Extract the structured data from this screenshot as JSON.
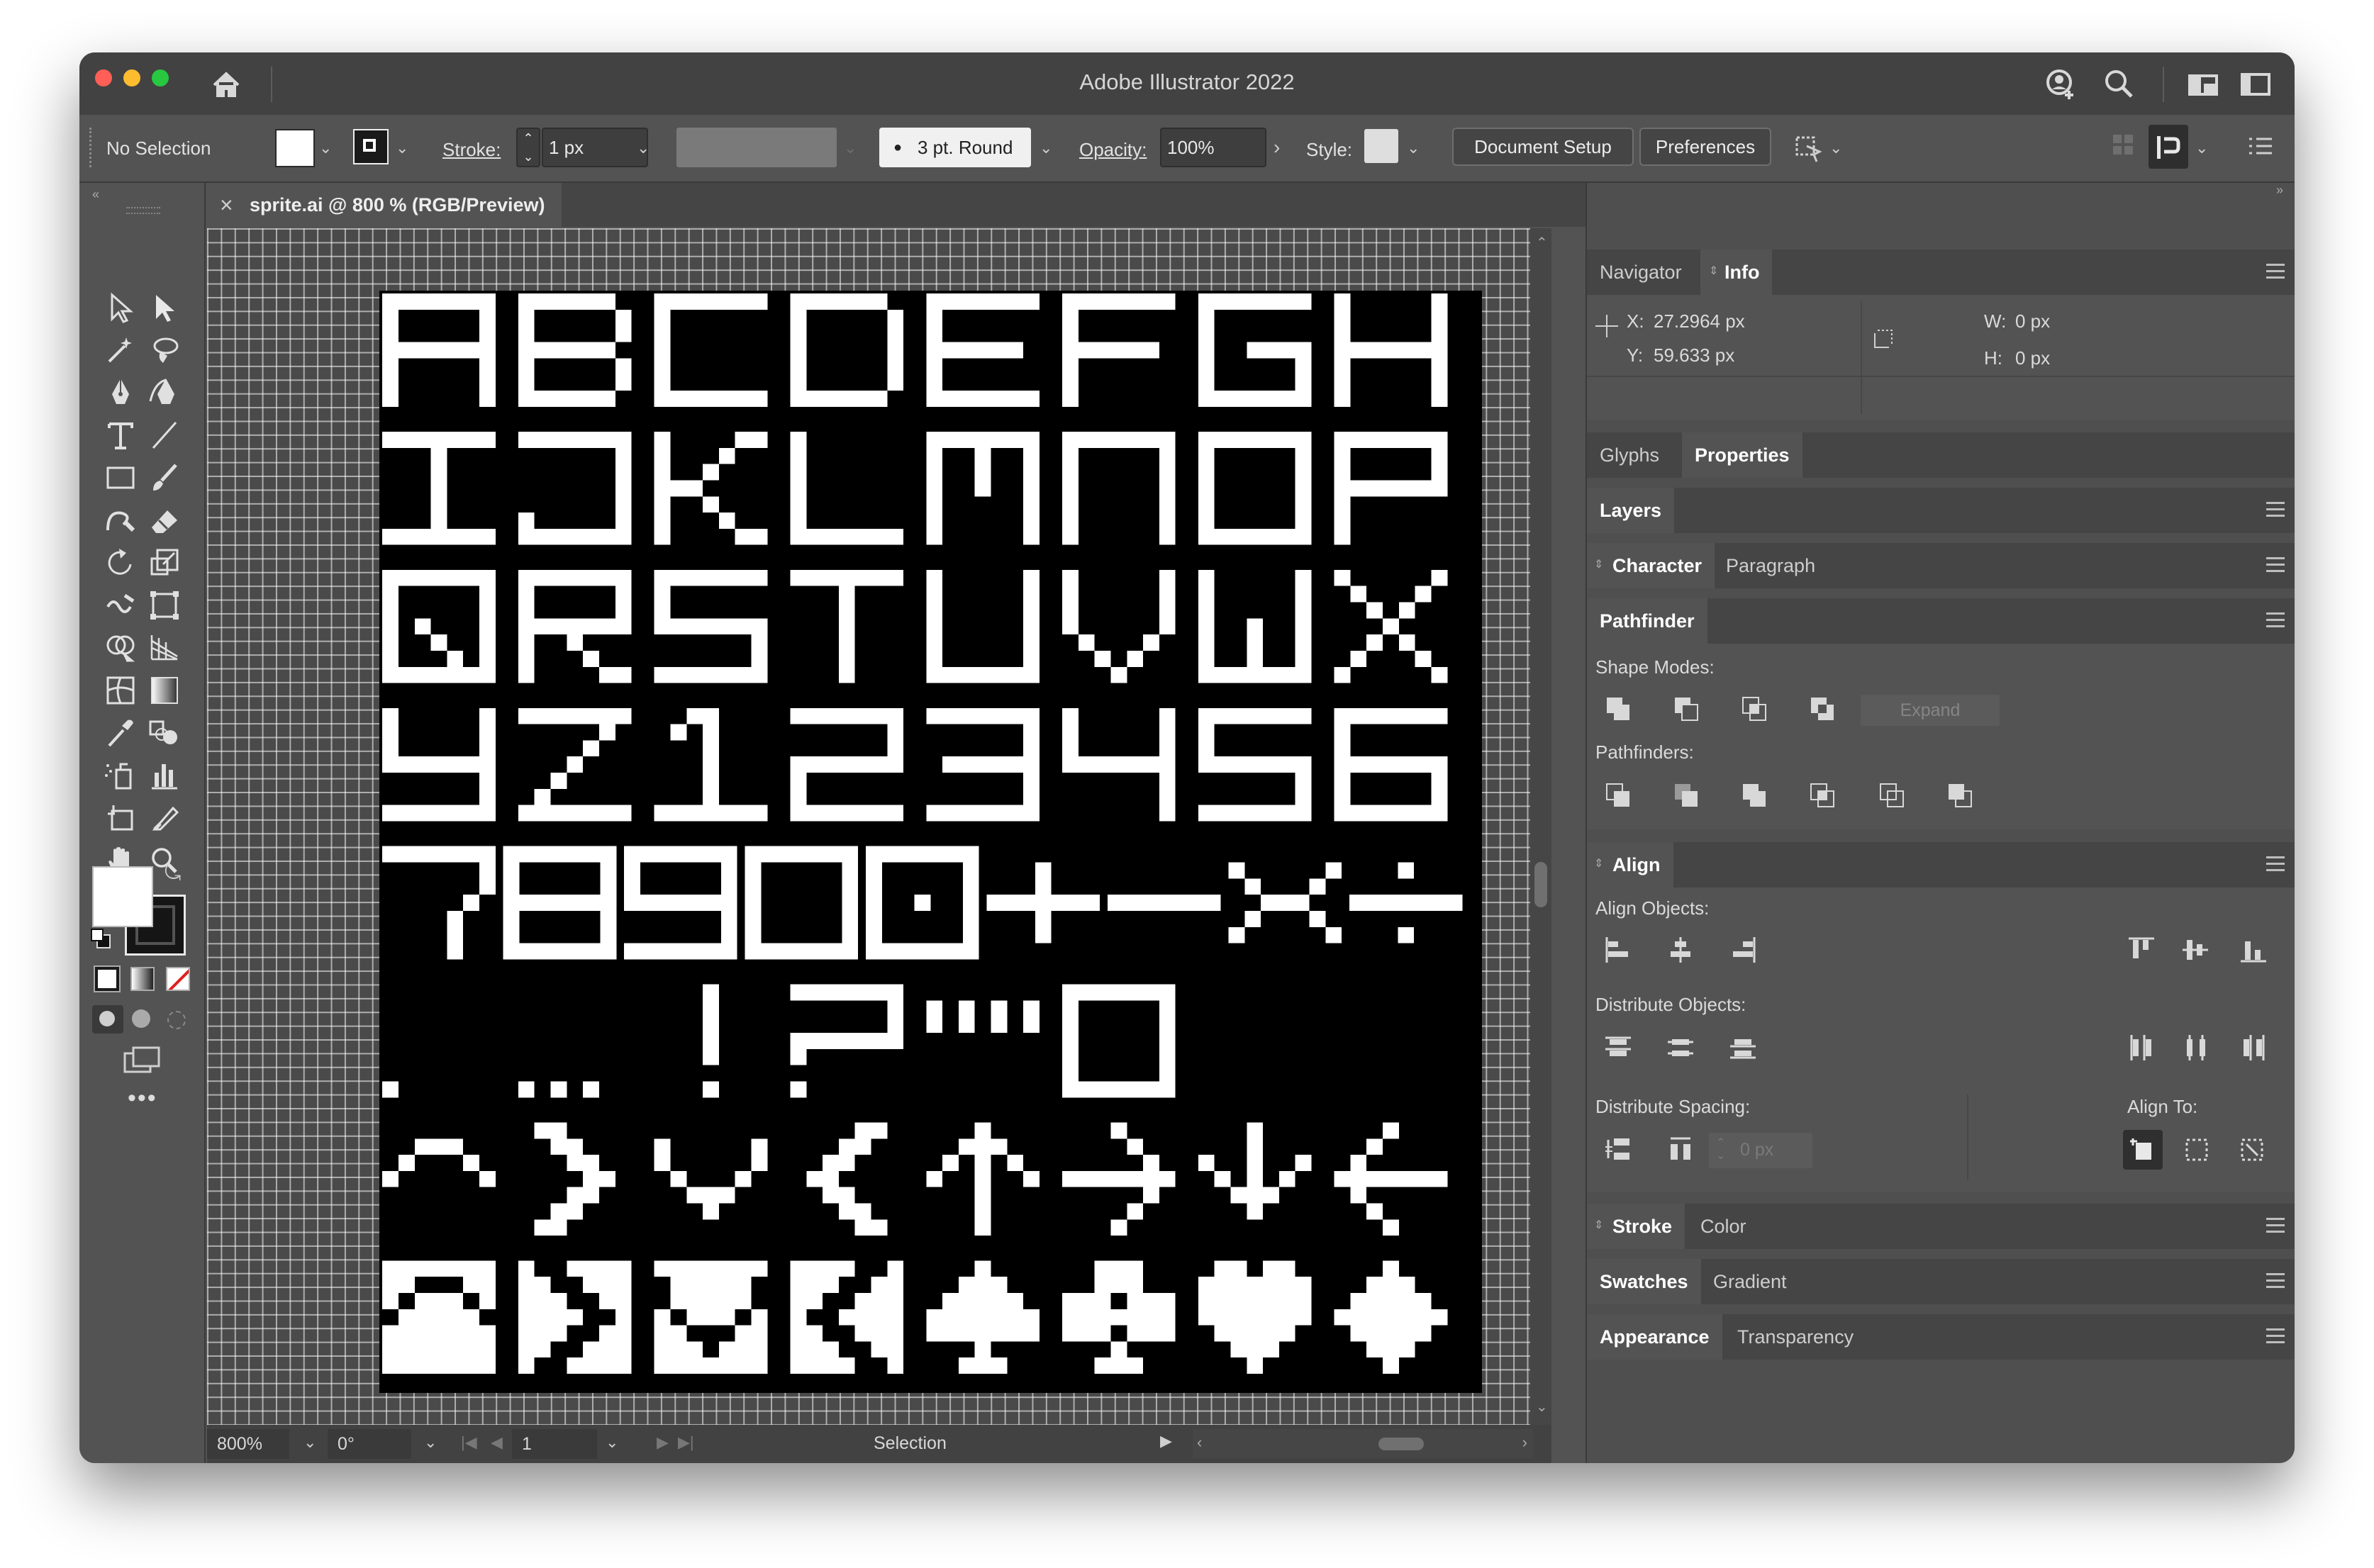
{
  "window": {
    "title": "Adobe Illustrator 2022"
  },
  "control_bar": {
    "selection_label": "No Selection",
    "stroke_label": "Stroke:",
    "stroke_value": "1 px",
    "brush_value": "3 pt. Round",
    "opacity_label": "Opacity:",
    "opacity_value": "100%",
    "style_label": "Style:",
    "document_setup_label": "Document Setup",
    "preferences_label": "Preferences"
  },
  "document_tab": {
    "close_glyph": "×",
    "title": "sprite.ai @ 800 % (RGB/Preview)"
  },
  "info_panel": {
    "tabs": [
      "Navigator",
      "Info"
    ],
    "active_tab": "Info",
    "x_label": "X:",
    "x_value": "27.2964 px",
    "y_label": "Y:",
    "y_value": "59.633 px",
    "w_label": "W:",
    "w_value": "0 px",
    "h_label": "H:",
    "h_value": "0 px"
  },
  "panels": {
    "glyphs_tab": "Glyphs",
    "properties_tab": "Properties",
    "layers_tab": "Layers",
    "character_tab": "Character",
    "paragraph_tab": "Paragraph",
    "pathfinder_tab": "Pathfinder",
    "shape_modes_label": "Shape Modes:",
    "expand_label": "Expand",
    "pathfinders_label": "Pathfinders:",
    "align_tab": "Align",
    "align_objects_label": "Align Objects:",
    "distribute_objects_label": "Distribute Objects:",
    "distribute_spacing_label": "Distribute Spacing:",
    "align_to_label": "Align To:",
    "spacing_value": "0 px",
    "stroke_tab": "Stroke",
    "color_tab": "Color",
    "swatches_tab": "Swatches",
    "gradient_tab": "Gradient",
    "appearance_tab": "Appearance",
    "transparency_tab": "Transparency"
  },
  "status_bar": {
    "zoom": "800%",
    "rotation": "0°",
    "artboard_number": "1",
    "tool_status": "Selection"
  },
  "artwork": {
    "glyph_rows": [
      [
        "A",
        "B",
        "C",
        "D",
        "E",
        "F",
        "G",
        "H"
      ],
      [
        "I",
        "J",
        "K",
        "L",
        "M",
        "N",
        "O",
        "P"
      ],
      [
        "Q",
        "R",
        "S",
        "T",
        "U",
        "V",
        "W",
        "X"
      ],
      [
        "Y",
        "Z",
        "1",
        "2",
        "3",
        "4",
        "5",
        "6"
      ],
      [
        "7",
        "8",
        "9",
        "0",
        "⊡",
        "+",
        "−",
        "×",
        "÷"
      ],
      [
        ".",
        "…",
        "!",
        "?",
        "::::",
        "✓"
      ],
      [
        "^",
        ">",
        "v",
        "<",
        "↑",
        "→",
        "↓",
        "←"
      ],
      [
        "▲",
        ">",
        "▼",
        "<",
        "♠",
        "♣",
        "♥",
        "♦"
      ]
    ]
  },
  "colors": {
    "window_bg": "#535353",
    "titlebar_bg": "#424242",
    "close_light": "#ff5f57",
    "minimize_light": "#febc2e",
    "zoom_light": "#28c840",
    "artboard": "#000000",
    "pixel": "#ffffff"
  },
  "icons": [
    "home-icon",
    "account-icon",
    "search-icon",
    "workspace-icon",
    "panel-toggle-icon",
    "selection-tool-icon",
    "direct-selection-tool-icon",
    "pen-tool-icon",
    "type-tool-icon",
    "line-tool-icon",
    "rectangle-tool-icon",
    "paintbrush-tool-icon",
    "shaper-tool-icon",
    "eraser-tool-icon",
    "rotate-tool-icon",
    "scale-tool-icon",
    "warp-tool-icon",
    "free-transform-tool-icon",
    "shape-builder-tool-icon",
    "perspective-grid-tool-icon",
    "mesh-tool-icon",
    "gradient-tool-icon",
    "eyedropper-tool-icon",
    "blend-tool-icon",
    "symbol-sprayer-tool-icon",
    "graph-tool-icon",
    "artboard-tool-icon",
    "slice-tool-icon",
    "hand-tool-icon",
    "zoom-tool-icon"
  ]
}
